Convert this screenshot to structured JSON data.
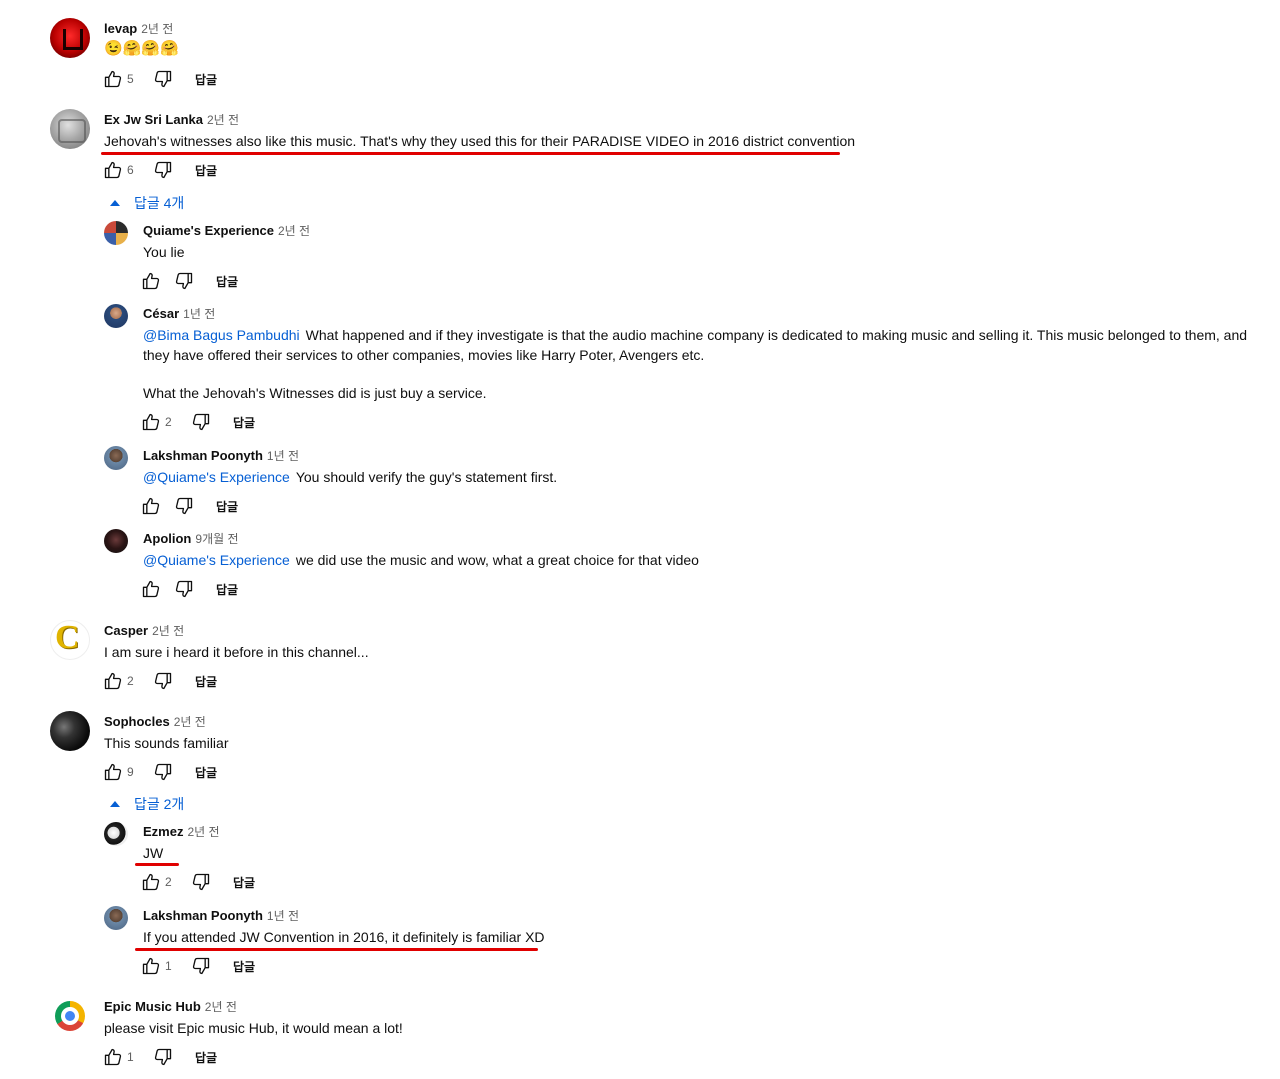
{
  "labels": {
    "reply": "답글"
  },
  "comments": [
    {
      "author": "levap",
      "time": "2년 전",
      "text": "😉🤗🤗🤗",
      "likes": "5"
    },
    {
      "author": "Ex Jw Sri Lanka",
      "time": "2년 전",
      "text": "Jehovah's witnesses also like this music. That's why they used this for their PARADISE VIDEO in 2016 district convention",
      "likes": "6",
      "replies_toggle": "답글 4개",
      "replies": [
        {
          "author": "Quiame's Experience",
          "time": "2년 전",
          "text": "You lie",
          "likes": ""
        },
        {
          "author": "César",
          "time": "1년 전",
          "mention": "@Bima Bagus Pambudhi",
          "text": "What happened and if they investigate is that the audio machine company is dedicated to making music and selling it. This music belonged to them, and they have offered their services to other companies, movies like Harry Poter, Avengers etc.",
          "text2": "What the Jehovah's Witnesses did is just buy a service.",
          "likes": "2"
        },
        {
          "author": "Lakshman Poonyth",
          "time": "1년 전",
          "mention": "@Quiame's Experience",
          "text": "You should verify the guy's statement first.",
          "likes": ""
        },
        {
          "author": "Apolion",
          "time": "9개월 전",
          "mention": "@Quiame's Experience",
          "text": "we did use the music and wow, what a great choice for that video",
          "likes": ""
        }
      ]
    },
    {
      "author": "Casper",
      "time": "2년 전",
      "text": "I am sure i heard it before in this channel...",
      "likes": "2"
    },
    {
      "author": "Sophocles",
      "time": "2년 전",
      "text": "This sounds familiar",
      "likes": "9",
      "replies_toggle": "답글 2개",
      "replies": [
        {
          "author": "Ezmez",
          "time": "2년 전",
          "text": "JW",
          "likes": "2"
        },
        {
          "author": "Lakshman Poonyth",
          "time": "1년 전",
          "text": "If you attended JW Convention in 2016, it definitely is familiar XD",
          "likes": "1"
        }
      ]
    },
    {
      "author": "Epic Music Hub",
      "time": "2년 전",
      "text": "please visit Epic music Hub, it would mean a lot!",
      "likes": "1"
    }
  ],
  "colors": {
    "accent": "#065fd4",
    "highlight": "#e00000",
    "muted": "#606060"
  },
  "icons": [
    "like-icon",
    "dislike-icon",
    "caret-up-icon"
  ]
}
